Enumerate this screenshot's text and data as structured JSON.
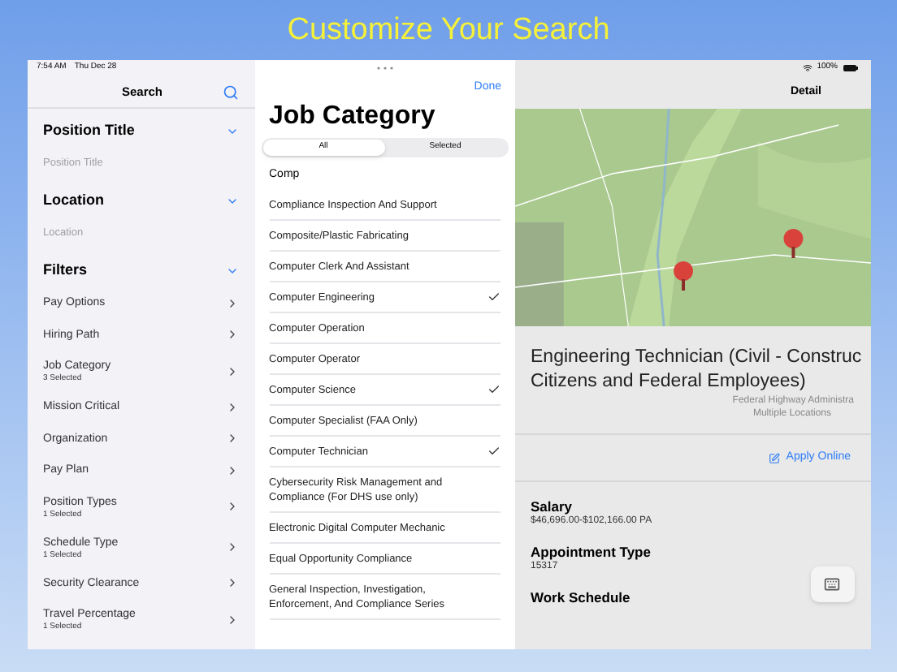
{
  "banner": "Customize Your Search",
  "status_bar": {
    "time": "7:54 AM",
    "date": "Thu Dec 28",
    "battery": "100%"
  },
  "search_pane": {
    "title": "Search",
    "sections": [
      {
        "title": "Position Title",
        "placeholder": "Position Title"
      },
      {
        "title": "Location",
        "placeholder": "Location"
      }
    ],
    "filters": {
      "title": "Filters",
      "items": [
        {
          "label": "Pay Options"
        },
        {
          "label": "Hiring Path"
        },
        {
          "label": "Job Category",
          "detail": "3 Selected"
        },
        {
          "label": "Mission Critical"
        },
        {
          "label": "Organization"
        },
        {
          "label": "Pay Plan"
        },
        {
          "label": "Position Types",
          "detail": "1 Selected"
        },
        {
          "label": "Schedule Type",
          "detail": "1 Selected"
        },
        {
          "label": "Security Clearance"
        },
        {
          "label": "Travel Percentage",
          "detail": "1 Selected"
        }
      ]
    }
  },
  "category_sheet": {
    "done": "Done",
    "title": "Job Category",
    "segments": [
      {
        "label": "All",
        "selected": true
      },
      {
        "label": "Selected",
        "selected": false
      }
    ],
    "search_value": "Comp",
    "items": [
      {
        "label": "Compliance Inspection And Support",
        "checked": false
      },
      {
        "label": "Composite/Plastic Fabricating",
        "checked": false
      },
      {
        "label": "Computer Clerk And Assistant",
        "checked": false
      },
      {
        "label": "Computer Engineering",
        "checked": true
      },
      {
        "label": "Computer Operation",
        "checked": false
      },
      {
        "label": "Computer Operator",
        "checked": false
      },
      {
        "label": "Computer Science",
        "checked": true
      },
      {
        "label": "Computer Specialist (FAA Only)",
        "checked": false
      },
      {
        "label": "Computer Technician",
        "checked": true
      },
      {
        "label": "Cybersecurity Risk Management and Compliance (For DHS use only)",
        "checked": false
      },
      {
        "label": "Electronic Digital Computer Mechanic",
        "checked": false
      },
      {
        "label": "Equal Opportunity Compliance",
        "checked": false
      },
      {
        "label": "General Inspection, Investigation, Enforcement, And Compliance Series",
        "checked": false
      }
    ]
  },
  "detail_pane": {
    "title": "Detail",
    "job_title": "Engineering Technician (Civil - Construc",
    "job_title_2": "Citizens and Federal Employees)",
    "agency": "Federal Highway Administra",
    "location": "Multiple Locations",
    "apply": "Apply Online",
    "fields": [
      {
        "label": "Salary",
        "value": "$46,696.00-$102,166.00 PA"
      },
      {
        "label": "Appointment Type",
        "value": "15317"
      },
      {
        "label": "Work Schedule"
      }
    ]
  }
}
